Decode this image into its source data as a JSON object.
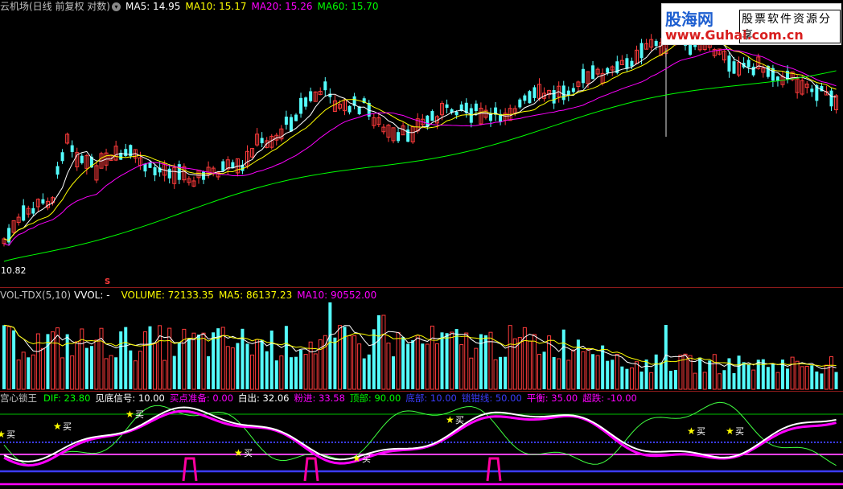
{
  "main_header": {
    "title": "云机场(日线 前复权 对数)",
    "ma5": "MA5: 14.95",
    "ma10": "MA10: 15.17",
    "ma20": "MA20: 15.26",
    "ma60": "MA60: 15.70"
  },
  "main_low_label": "10.82",
  "marker_label": "S",
  "vol_header": {
    "name": "VOL-TDX(5,10)",
    "vvol": "VVOL: -",
    "volume": "VOLUME: 72133.35",
    "ma5": "MA5: 86137.23",
    "ma10": "MA10: 90552.00"
  },
  "ind_header": {
    "name": "宫心锁王",
    "dif": "DIF: 23.80",
    "bottom_signal": "见底信号: 10.00",
    "buy_prep": "买点准备: 0.00",
    "white_out": "白出: 32.06",
    "pink_in": "粉进: 33.58",
    "top": "顶部: 90.00",
    "bottom": "底部: 10.00",
    "lock_line": "锁钳线: 50.00",
    "balance": "平衡: 35.00",
    "oversold": "超跌: -10.00"
  },
  "buy_label": "买",
  "watermark": {
    "logo": "股海网",
    "tag": "股票软件资源分享",
    "url": "www.Guhai.com.cn"
  },
  "colors": {
    "up": "#ff3b3b",
    "down": "#54fcfc",
    "ma5": "#ffffff",
    "ma10": "#ffff00",
    "ma20": "#ff00ff",
    "ma60": "#00ff00",
    "bg": "#000000"
  },
  "icons": {
    "dropdown": "chevron-down-icon",
    "buy_star": "star-icon"
  }
}
